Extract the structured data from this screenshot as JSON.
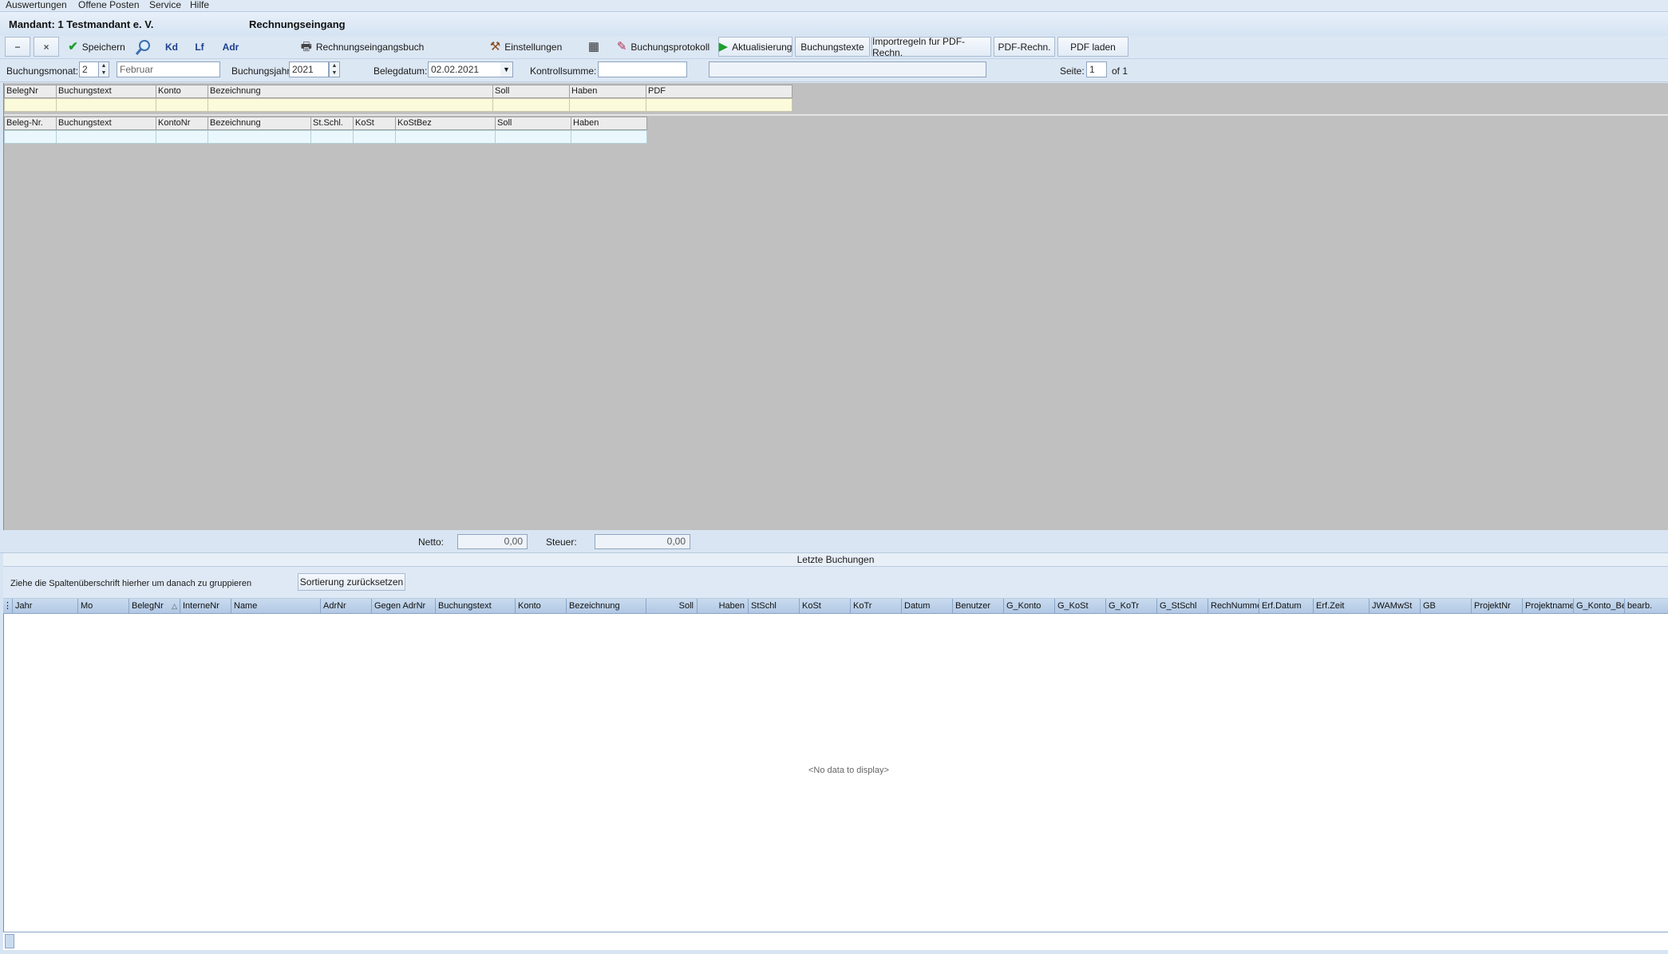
{
  "menu": [
    "Auswertungen",
    "Offene Posten",
    "Service",
    "Hilfe"
  ],
  "header": {
    "mandant": "Mandant: 1 Testmandant e. V.",
    "module": "Rechnungseingang"
  },
  "toolbar": {
    "minus": "−",
    "close": "×",
    "save": "Speichern",
    "kd": "Kd",
    "lf": "Lf",
    "adr": "Adr",
    "journal": "Rechnungseingangsbuch",
    "settings": "Einstellungen",
    "protocol": "Buchungsprotokoll",
    "refresh": "Aktualisierung",
    "texts": "Buchungstexte",
    "import_rules": "Importregeln fur PDF-Rechn.",
    "pdf_invoice": "PDF-Rechn.",
    "pdf_load": "PDF laden"
  },
  "filters": {
    "month_label": "Buchungsmonat:",
    "month_value": "2",
    "month_name": "Februar",
    "year_label": "Buchungsjahr:",
    "year_value": "2021",
    "date_label": "Belegdatum:",
    "date_value": "02.02.2021",
    "checksum_label": "Kontrollsumme:",
    "checksum_value": "",
    "page_label": "Seite:",
    "page_value": "1",
    "page_total": "of 1"
  },
  "entry_grid1": [
    "BelegNr",
    "Buchungstext",
    "Konto",
    "Bezeichnung",
    "Soll",
    "Haben",
    "PDF"
  ],
  "entry_grid2": [
    "Beleg-Nr.",
    "Buchungstext",
    "KontoNr",
    "Bezeichnung",
    "St.Schl.",
    "KoSt",
    "KoStBez",
    "Soll",
    "Haben"
  ],
  "totals": {
    "netto_label": "Netto:",
    "netto_value": "0,00",
    "steuer_label": "Steuer:",
    "steuer_value": "0,00"
  },
  "recent": {
    "title": "Letzte Buchungen",
    "group_hint": "Ziehe die Spaltenüberschrift hierher um danach zu gruppieren",
    "reset_sort": "Sortierung zurücksetzen",
    "columns": [
      "Jahr",
      "Mo",
      "BelegNr",
      "InterneNr",
      "Name",
      "AdrNr",
      "Gegen AdrNr",
      "Buchungstext",
      "Konto",
      "Bezeichnung",
      "Soll",
      "Haben",
      "StSchl",
      "KoSt",
      "KoTr",
      "Datum",
      "Benutzer",
      "G_Konto",
      "G_KoSt",
      "G_KoTr",
      "G_StSchl",
      "RechNummer",
      "Erf.Datum",
      "Erf.Zeit",
      "JWAMwSt",
      "GB",
      "ProjektNr",
      "Projektname",
      "G_Konto_Be",
      "bearb."
    ],
    "empty": "<No data to display>"
  }
}
